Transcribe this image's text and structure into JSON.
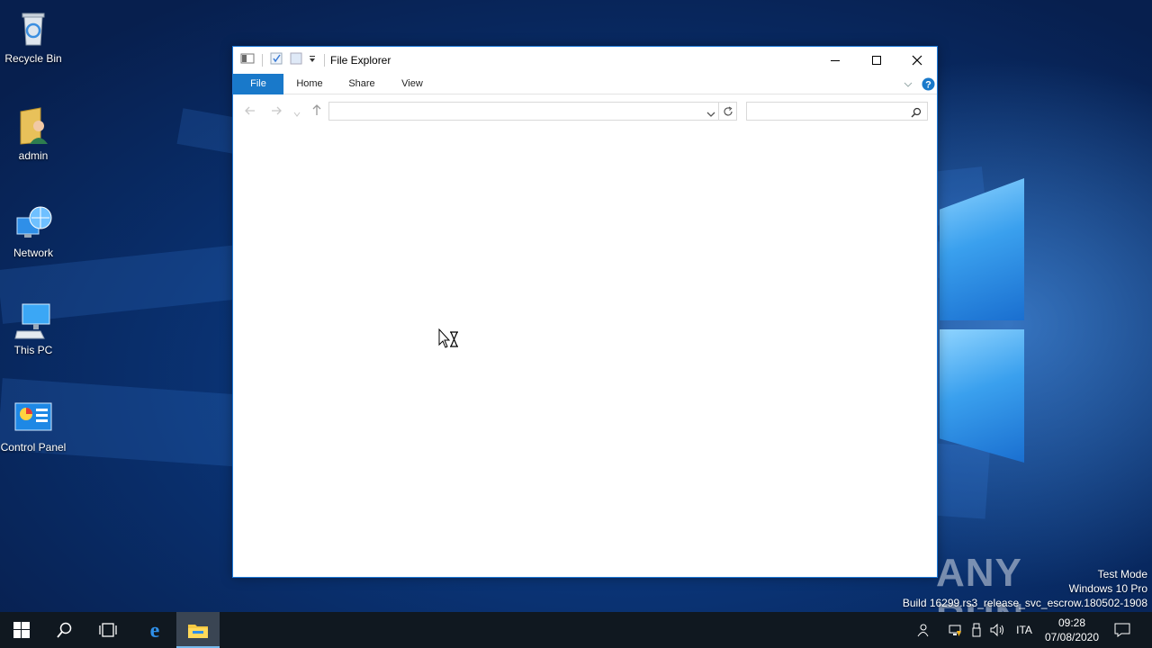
{
  "desktop": {
    "icons": [
      {
        "label": "Recycle Bin",
        "icon": "recycle-bin-icon"
      },
      {
        "label": "admin",
        "icon": "user-folder-icon"
      },
      {
        "label": "Network",
        "icon": "network-icon"
      },
      {
        "label": "This PC",
        "icon": "computer-icon"
      },
      {
        "label": "Control Panel",
        "icon": "control-panel-icon"
      }
    ]
  },
  "explorer": {
    "title": "File Explorer",
    "tabs": {
      "file": "File",
      "home": "Home",
      "share": "Share",
      "view": "View"
    },
    "address_value": "",
    "search_placeholder": ""
  },
  "watermark": {
    "brand": "ANY RUN",
    "line1": "Test Mode",
    "line2": "Windows 10 Pro",
    "line3": "Build 16299.rs3_release_svc_escrow.180502-1908"
  },
  "taskbar": {
    "language": "ITA",
    "time": "09:28",
    "date": "07/08/2020"
  },
  "colors": {
    "accent": "#1979ca",
    "taskbar": "#101820",
    "window_border": "#1f7ad8"
  }
}
